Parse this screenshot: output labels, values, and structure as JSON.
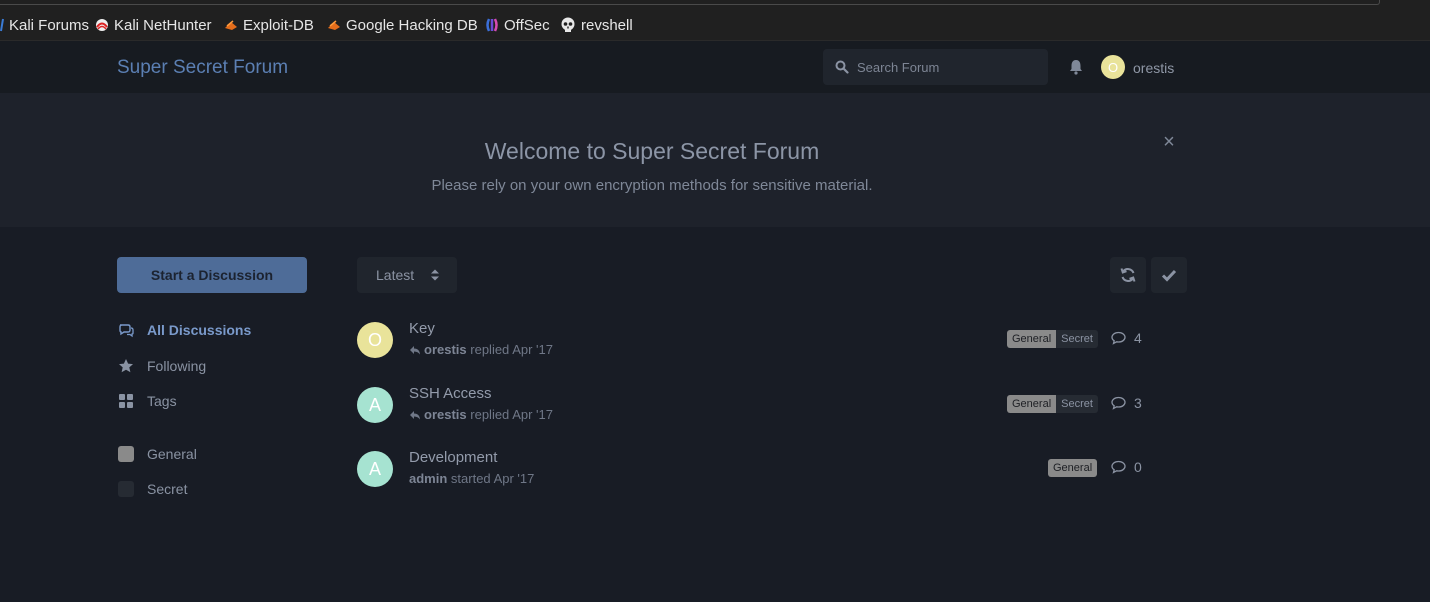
{
  "bookmarks": [
    {
      "label": "Kali Forums",
      "icon": "kali-dragon-icon"
    },
    {
      "label": "Kali NetHunter",
      "icon": "nethunter-icon"
    },
    {
      "label": "Exploit-DB",
      "icon": "exploit-db-icon"
    },
    {
      "label": "Google Hacking DB",
      "icon": "ghdb-icon"
    },
    {
      "label": "OffSec",
      "icon": "offsec-icon"
    },
    {
      "label": "revshell",
      "icon": "skull-icon"
    }
  ],
  "header": {
    "brand": "Super Secret Forum",
    "search_placeholder": "Search Forum",
    "user_initial": "O",
    "username": "orestis"
  },
  "hero": {
    "title": "Welcome to Super Secret Forum",
    "subtitle": "Please rely on your own encryption methods for sensitive material.",
    "close": "×"
  },
  "sidebar": {
    "start_label": "Start a Discussion",
    "nav": [
      {
        "label": "All Discussions",
        "icon": "comments-icon"
      },
      {
        "label": "Following",
        "icon": "star-icon"
      },
      {
        "label": "Tags",
        "icon": "grid-icon"
      }
    ],
    "tags": [
      {
        "label": "General",
        "color": "#8a8a8a"
      },
      {
        "label": "Secret",
        "color": "#262b33"
      }
    ]
  },
  "toolbar": {
    "sort_label": "Latest"
  },
  "discussions": [
    {
      "title": "Key",
      "avatar_initial": "O",
      "avatar_color": "#e9e39a",
      "user": "orestis",
      "action": "replied",
      "time": "Apr '17",
      "replied": true,
      "tags": [
        "General",
        "Secret"
      ],
      "count": "4"
    },
    {
      "title": "SSH Access",
      "avatar_initial": "A",
      "avatar_color": "#a6e3d1",
      "user": "orestis",
      "action": "replied",
      "time": "Apr '17",
      "replied": true,
      "tags": [
        "General",
        "Secret"
      ],
      "count": "3"
    },
    {
      "title": "Development",
      "avatar_initial": "A",
      "avatar_color": "#a6e3d1",
      "user": "admin",
      "action": "started",
      "time": "Apr '17",
      "replied": false,
      "tags": [
        "General"
      ],
      "count": "0"
    }
  ],
  "colors": {
    "accent": "#5b7fb3",
    "background": "#181c25"
  }
}
